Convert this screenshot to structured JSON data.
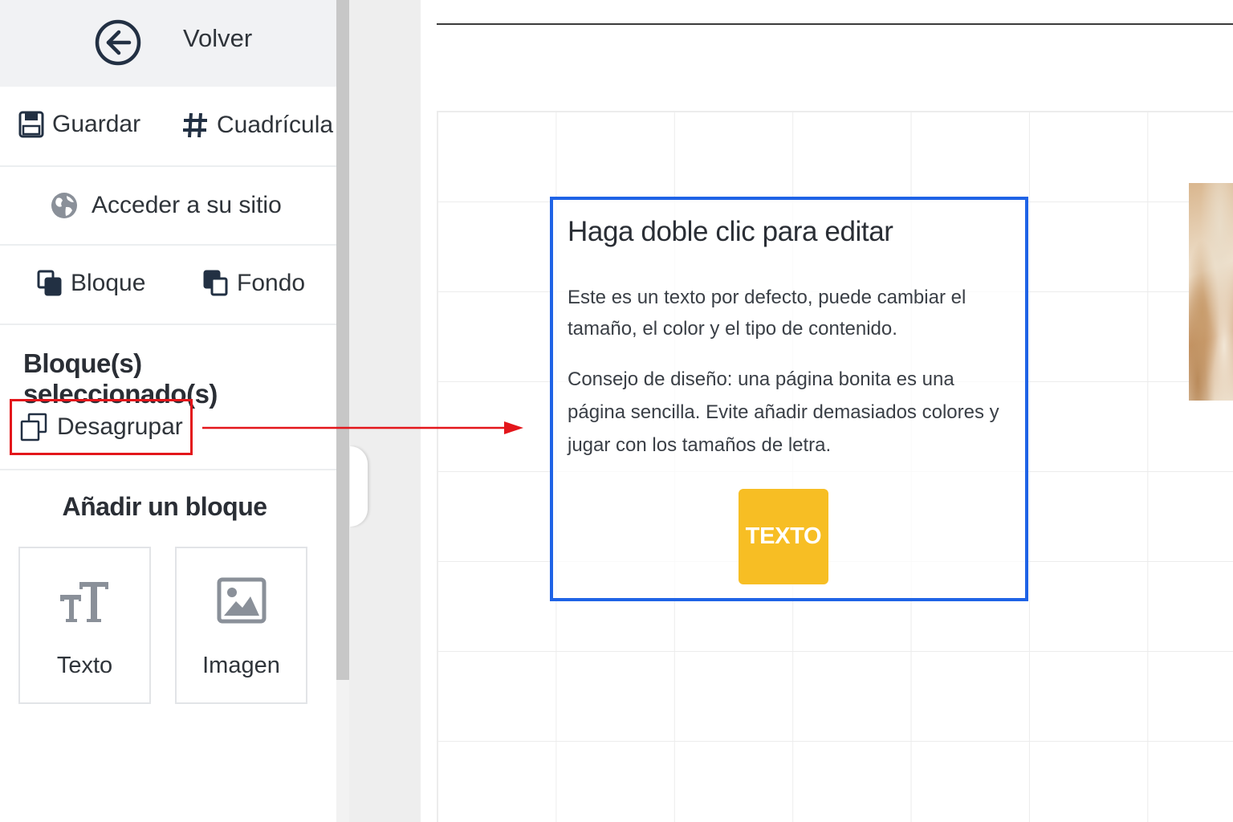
{
  "sidebar": {
    "back_label": "Volver",
    "save_label": "Guardar",
    "grid_label": "Cuadrícula",
    "site_label": "Acceder a su sitio",
    "block_label": "Bloque",
    "background_label": "Fondo",
    "selected_title": "Bloque(s) seleccionado(s)",
    "ungroup_label": "Desagrupar",
    "add_block_title": "Añadir un bloque",
    "tiles": [
      {
        "label": "Texto",
        "icon": "text-size-icon"
      },
      {
        "label": "Imagen",
        "icon": "image-icon"
      }
    ]
  },
  "canvas": {
    "text_block": {
      "title": "Haga doble clic para editar",
      "paragraph1": "Este es un texto por defecto, puede cambiar el tamaño, el color y el tipo de contenido.",
      "paragraph2": "Consejo de diseño: una página bonita es una página sencilla. Evite añadir demasiados colores y jugar con los tamaños de letra.",
      "button_label": "TEXTO"
    }
  },
  "colors": {
    "selection_border": "#1f63e6",
    "highlight_annotation": "#e3161b",
    "button_yellow": "#f7be24"
  }
}
